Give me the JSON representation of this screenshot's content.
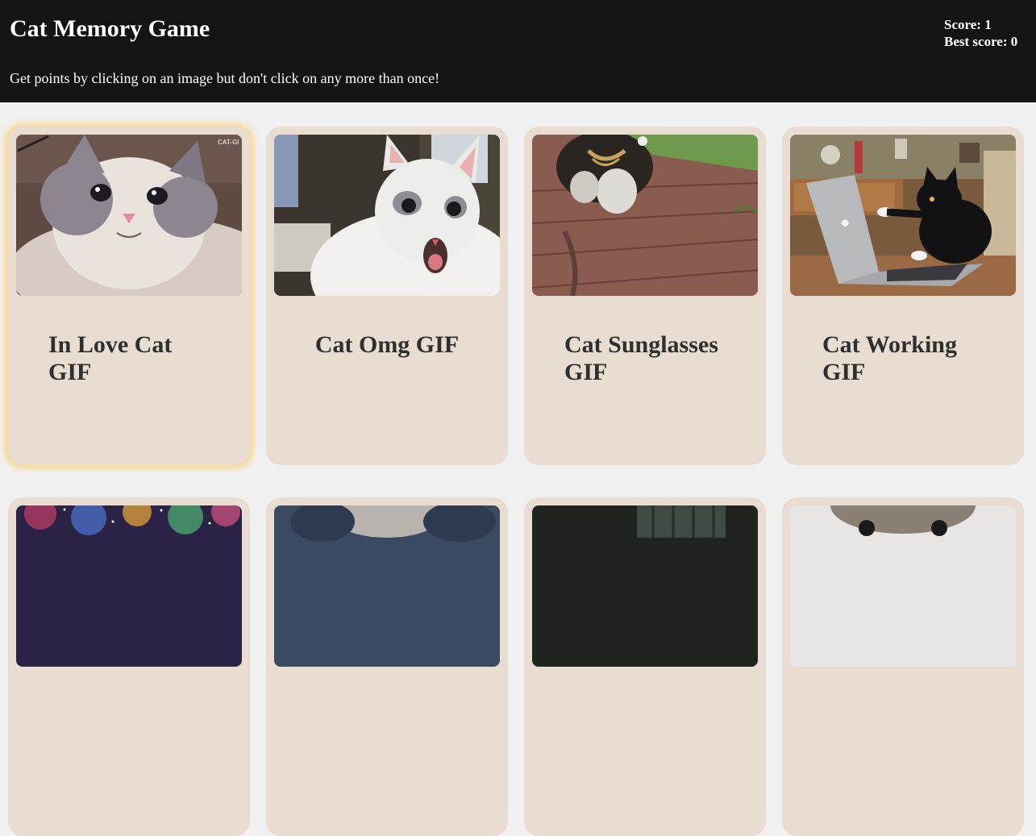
{
  "header": {
    "title": "Cat Memory Game",
    "instructions": "Get points by clicking on an image but don't click on any more than once!",
    "score_text": "Score: 1",
    "best_score_text": "Best score: 0"
  },
  "cards": [
    {
      "caption": "In Love Cat GIF",
      "image_badge": "CAT-GI"
    },
    {
      "caption": "Cat Omg GIF"
    },
    {
      "caption": "Cat Sunglasses GIF"
    },
    {
      "caption": "Cat Working GIF"
    },
    {
      "caption": ""
    },
    {
      "caption": ""
    },
    {
      "caption": ""
    },
    {
      "caption": ""
    }
  ],
  "colors": {
    "header_bg": "#151413",
    "page_bg": "#f0f0f0",
    "card_bg": "#e9ddd1",
    "selected_glow": "#f8d58a",
    "caption_text": "#2f2f2f"
  }
}
